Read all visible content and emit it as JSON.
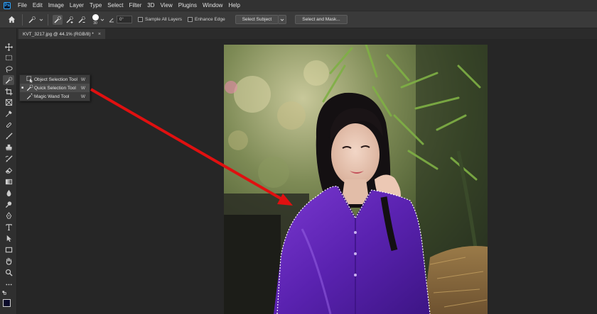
{
  "menu": {
    "items": [
      "File",
      "Edit",
      "Image",
      "Layer",
      "Type",
      "Select",
      "Filter",
      "3D",
      "View",
      "Plugins",
      "Window",
      "Help"
    ]
  },
  "options": {
    "brush_size": "30",
    "angle": "0°",
    "sample_all_layers": "Sample All Layers",
    "enhance_edge": "Enhance Edge",
    "select_subject": "Select Subject",
    "select_and_mask": "Select and Mask..."
  },
  "document": {
    "tab_title": "KVT_3217.jpg @ 44.1% (RGB/8) *",
    "close": "×"
  },
  "flyout": {
    "items": [
      {
        "label": "Object Selection Tool",
        "shortcut": "W",
        "bullet": ""
      },
      {
        "label": "Quick Selection Tool",
        "shortcut": "W",
        "bullet": "■"
      },
      {
        "label": "Magic Wand Tool",
        "shortcut": "W",
        "bullet": ""
      }
    ]
  },
  "colors": {
    "foreground": "#0a0a2a",
    "background": "#ffffff",
    "annotation_arrow": "#e01010"
  },
  "icons": {
    "toolbar": [
      "move-icon",
      "marquee-icon",
      "lasso-icon",
      "quick-selection-icon",
      "crop-icon",
      "frame-icon",
      "eyedropper-icon",
      "healing-brush-icon",
      "brush-icon",
      "clone-stamp-icon",
      "history-brush-icon",
      "eraser-icon",
      "gradient-icon",
      "blur-icon",
      "dodge-icon",
      "pen-icon",
      "type-icon",
      "path-selection-icon",
      "rectangle-icon",
      "hand-icon",
      "zoom-icon",
      "more-tools-icon"
    ]
  }
}
